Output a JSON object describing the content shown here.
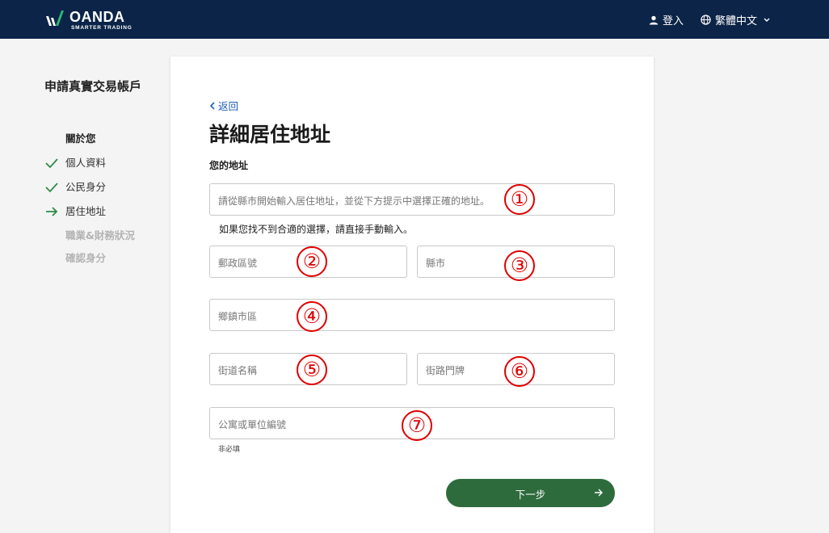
{
  "header": {
    "brand": "OANDA",
    "tagline": "SMARTER TRADING",
    "login": "登入",
    "language": "繁體中文",
    "bg_color": "#0b2447"
  },
  "sidebar": {
    "title": "申請真實交易帳戶",
    "steps": [
      {
        "label": "關於您",
        "state": "heading"
      },
      {
        "label": "個人資料",
        "state": "done",
        "icon": "check-icon"
      },
      {
        "label": "公民身分",
        "state": "done",
        "icon": "check-icon"
      },
      {
        "label": "居住地址",
        "state": "current",
        "icon": "arrow-right-icon"
      },
      {
        "label": "職業&財務狀況",
        "state": "pending"
      },
      {
        "label": "確認身分",
        "state": "pending"
      }
    ]
  },
  "form": {
    "back": "返回",
    "title": "詳細居住地址",
    "section_label": "您的地址",
    "address_search_placeholder": "請從縣市開始輸入居住地址，並從下方提示中選擇正確的地址。",
    "hint": "如果您找不到合適的選擇，請直接手動輸入。",
    "postal_code_placeholder": "郵政區號",
    "city_placeholder": "縣市",
    "district_placeholder": "鄉鎮市區",
    "street_name_placeholder": "街道名稱",
    "street_number_placeholder": "街路門牌",
    "unit_placeholder": "公寓或單位編號",
    "optional_note": "非必填",
    "next_button": "下一步",
    "accent_color": "#2e6b3c"
  },
  "annotations": [
    "①",
    "②",
    "③",
    "④",
    "⑤",
    "⑥",
    "⑦"
  ]
}
